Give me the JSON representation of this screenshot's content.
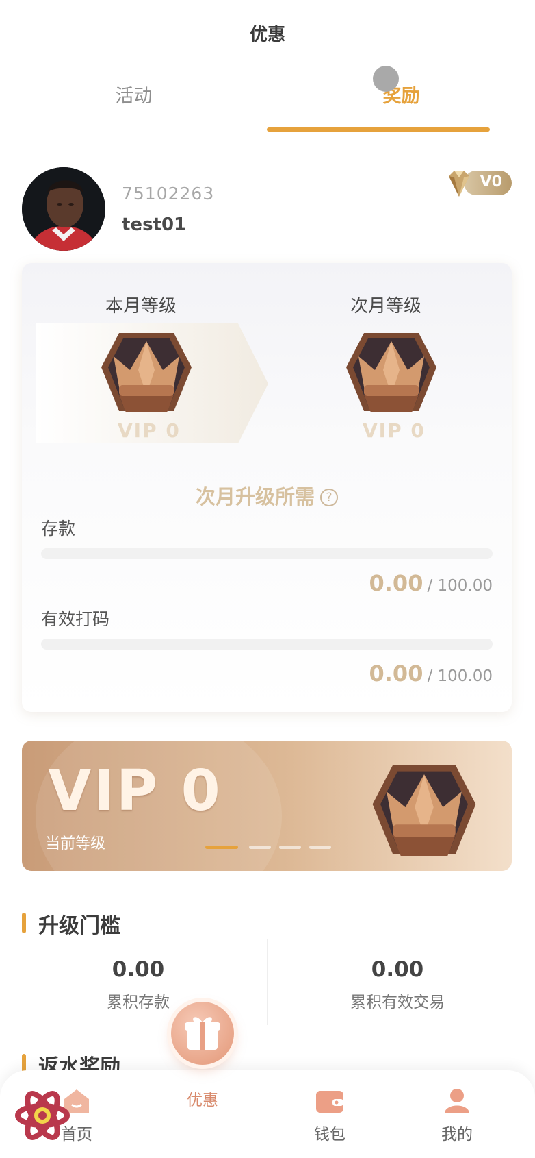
{
  "header": {
    "title": "优惠"
  },
  "tabs": [
    {
      "label": "活动",
      "active": false
    },
    {
      "label": "奖励",
      "active": true
    }
  ],
  "profile": {
    "user_id": "75102263",
    "username": "test01",
    "vip_badge": "V0"
  },
  "level_card": {
    "current_label": "本月等级",
    "next_label": "次月等级",
    "current_vip": "VIP 0",
    "next_vip": "VIP 0",
    "need_title": "次月升级所需",
    "help_icon": "question-circle-icon",
    "requirements": [
      {
        "label": "存款",
        "current": "0.00",
        "target": "/ 100.00",
        "progress": 0
      },
      {
        "label": "有效打码",
        "current": "0.00",
        "target": "/ 100.00",
        "progress": 0
      }
    ]
  },
  "vip_banner": {
    "level": "VIP 0",
    "subtitle": "当前等级",
    "slides": 4,
    "active_slide": 0
  },
  "threshold": {
    "title": "升级门槛",
    "items": [
      {
        "value": "0.00",
        "label": "累积存款"
      },
      {
        "value": "0.00",
        "label": "累积有效交易"
      }
    ]
  },
  "rebate": {
    "title": "返水奖励"
  },
  "tabbar": {
    "items": [
      {
        "label": "首页",
        "icon": "home-icon"
      },
      {
        "label": "优惠",
        "icon": "gift-icon",
        "active": true
      },
      {
        "label": "钱包",
        "icon": "wallet-icon"
      },
      {
        "label": "我的",
        "icon": "user-icon"
      }
    ]
  },
  "colors": {
    "accent": "#e6a23c",
    "gold_text": "#d2b996",
    "bronze": "#c99c78"
  }
}
